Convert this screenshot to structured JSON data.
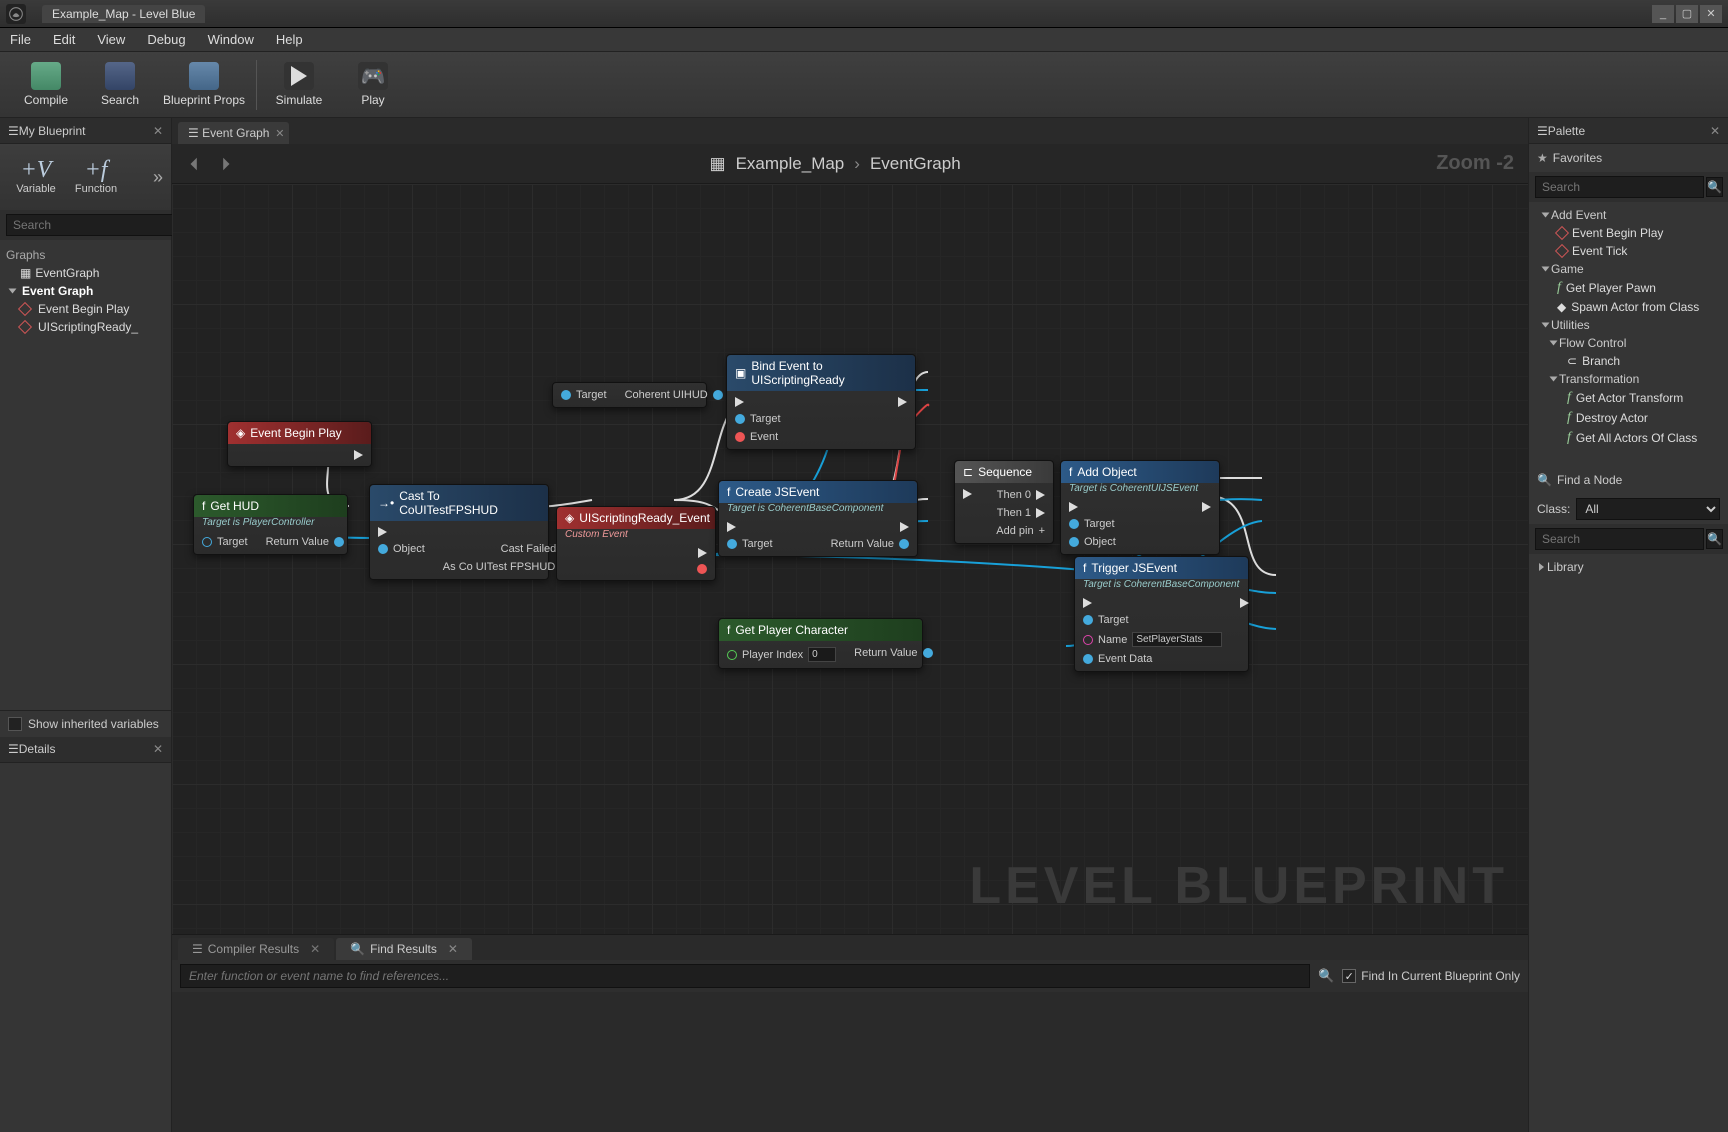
{
  "window": {
    "title": "Example_Map - Level Blue"
  },
  "winbtns": {
    "min": "_",
    "max": "▢",
    "close": "✕"
  },
  "menu": [
    "File",
    "Edit",
    "View",
    "Debug",
    "Window",
    "Help"
  ],
  "toolbar": [
    {
      "label": "Compile"
    },
    {
      "label": "Search"
    },
    {
      "label": "Blueprint Props"
    },
    {
      "label": "Simulate"
    },
    {
      "label": "Play"
    }
  ],
  "left": {
    "myBlueprint": "My Blueprint",
    "variable": "Variable",
    "function": "Function",
    "searchPlaceholder": "Search",
    "graphsLabel": "Graphs",
    "eventGraph": "EventGraph",
    "eventGraphCat": "Event Graph",
    "evtBeginPlay": "Event Begin Play",
    "evtUIScript": "UIScriptingReady_",
    "showInherited": "Show inherited variables",
    "details": "Details"
  },
  "center": {
    "tabEventGraph": "Event Graph",
    "bcMap": "Example_Map",
    "bcGraph": "EventGraph",
    "zoom": "Zoom -2",
    "watermark": "LEVEL BLUEPRINT",
    "compilerResults": "Compiler Results",
    "findResults": "Find Results",
    "findPlaceholder": "Enter function or event name to find references...",
    "findInCurrent": "Find In Current Blueprint Only"
  },
  "nodes": {
    "eventBeginPlay": "Event Begin Play",
    "getHud": {
      "title": "Get HUD",
      "sub": "Target is PlayerController",
      "pTarget": "Target",
      "pReturn": "Return Value"
    },
    "cast": {
      "title": "Cast To CoUITestFPSHUD",
      "pObject": "Object",
      "pCastFailed": "Cast Failed",
      "pAs": "As Co UITest FPSHUD"
    },
    "targetHud": {
      "pTarget": "Target",
      "pOut": "Coherent UIHUD"
    },
    "uiScriptReady": {
      "title": "UIScriptingReady_Event",
      "sub": "Custom Event"
    },
    "bindEvent": {
      "title": "Bind Event to UIScriptingReady",
      "pTarget": "Target",
      "pEvent": "Event"
    },
    "createJS": {
      "title": "Create JSEvent",
      "sub": "Target is CoherentBaseComponent",
      "pTarget": "Target",
      "pReturn": "Return Value"
    },
    "getPlayerChar": {
      "title": "Get Player Character",
      "pIndex": "Player Index",
      "pIndexVal": "0",
      "pReturn": "Return Value"
    },
    "sequence": {
      "title": "Sequence",
      "pThen0": "Then 0",
      "pThen1": "Then 1",
      "pAddPin": "Add pin"
    },
    "addObject": {
      "title": "Add Object",
      "sub": "Target is CoherentUIJSEvent",
      "pTarget": "Target",
      "pObject": "Object"
    },
    "triggerJS": {
      "title": "Trigger JSEvent",
      "sub": "Target is CoherentBaseComponent",
      "pTarget": "Target",
      "pName": "Name",
      "pNameVal": "SetPlayerStats",
      "pEventData": "Event Data"
    }
  },
  "palette": {
    "title": "Palette",
    "favorites": "Favorites",
    "searchPlaceholder": "Search",
    "addEvent": "Add Event",
    "evtBeginPlay": "Event Begin Play",
    "evtTick": "Event Tick",
    "game": "Game",
    "getPlayerPawn": "Get Player Pawn",
    "spawnActor": "Spawn Actor from Class",
    "utilities": "Utilities",
    "flowControl": "Flow Control",
    "branch": "Branch",
    "transformation": "Transformation",
    "getActorTransform": "Get Actor Transform",
    "destroyActor": "Destroy Actor",
    "getAllActors": "Get All Actors Of Class",
    "findNode": "Find a Node",
    "classLabel": "Class:",
    "classValue": "All",
    "library": "Library"
  }
}
